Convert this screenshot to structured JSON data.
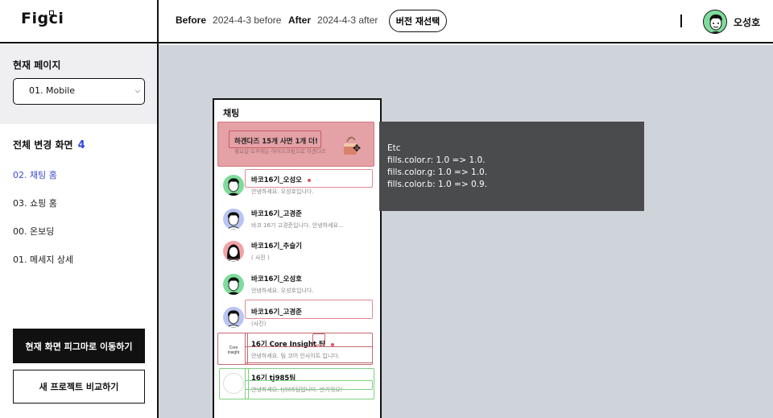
{
  "app": {
    "logo": "Figci"
  },
  "header": {
    "before_label": "Before",
    "before_value": "2024-4-3 before",
    "after_label": "After",
    "after_value": "2024-4-3 after",
    "reselect_button": "버전 재선택",
    "user_name": "오성호"
  },
  "sidebar": {
    "current_page_label": "현재 페이지",
    "selected_page": "01. Mobile",
    "changed_title": "전체 변경 화면",
    "changed_count": "4",
    "items": [
      {
        "label": "02. 채팅 홈",
        "active": true
      },
      {
        "label": "03. 쇼핑 홈",
        "active": false
      },
      {
        "label": "00. 온보딩",
        "active": false
      },
      {
        "label": "01. 메세지 상세",
        "active": false
      }
    ],
    "open_in_figma_button": "현재 화면 피그마로 이동하기",
    "compare_new_button": "새 프로젝트 비교하기"
  },
  "phone": {
    "title": "채팅",
    "banner_title": "하겐다즈 15개 사면 1개 더!",
    "banner_sub": "월요일·오후에는 아이스크림으로 하겐다즈",
    "chats": [
      {
        "name": "바코16기_오성오",
        "message": "안녕하세요. 오성호입니다.",
        "dot": true
      },
      {
        "name": "바코16기_고경준",
        "message": "바코 16기 고경준입니다. 안녕하세요...",
        "dot": false
      },
      {
        "name": "바코16기_추슬기",
        "message": "( 사진 )",
        "dot": false
      },
      {
        "name": "바코16기_오성호",
        "message": "안녕하세요. 오성호입니다.",
        "dot": false
      },
      {
        "name": "바코16기_고경준",
        "message": "(사진)",
        "dot": false
      },
      {
        "name": "16기 Core Insight 팀",
        "message": "안녕하세요. 팀 코어 인사이트 입니다.",
        "dot": true,
        "avatar_text": "Core Insight"
      },
      {
        "name": "16기 tj985팀",
        "message": "안녕하세요. tj985팀입니다. 반가워요!",
        "dot": false
      }
    ]
  },
  "tooltip": {
    "title": "Etc",
    "lines": [
      "fills.color.r: 1.0 => 1.0.",
      "fills.color.g: 1.0 => 1.0.",
      "fills.color.b: 1.0 => 0.9."
    ]
  },
  "colors": {
    "accent_blue": "#3b4bd6",
    "highlight_red": "#e4a1a6",
    "highlight_green": "#7fd07f",
    "canvas_bg": "#cfd3da",
    "tooltip_bg": "#4a4b4d"
  }
}
